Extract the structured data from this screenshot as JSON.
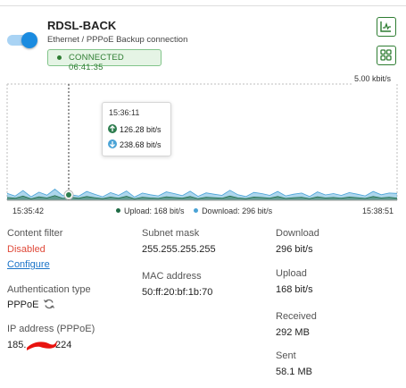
{
  "connection": {
    "name": "RDSL-BACK",
    "description": "Ethernet / PPPoE Backup connection",
    "status": "CONNECTED 06:41:35",
    "enabled": true
  },
  "chart": {
    "max_label": "5.00 kbit/s",
    "x_start": "15:35:42",
    "x_end": "15:38:51",
    "legend_upload": "Upload: 168 bit/s",
    "legend_download": "Download: 296 bit/s",
    "tooltip": {
      "time": "15:36:11",
      "upload": "126.28 bit/s",
      "download": "238.68 bit/s"
    }
  },
  "chart_data": {
    "type": "area",
    "ylim": [
      0,
      5000
    ],
    "series": [
      {
        "name": "Upload",
        "color": "#1f6b45",
        "values": [
          120,
          90,
          180,
          60,
          150,
          100,
          200,
          80,
          126,
          90,
          160,
          110,
          70,
          140,
          90,
          170,
          60,
          130,
          100,
          80,
          150,
          120,
          90,
          160,
          70,
          130,
          110,
          90,
          180,
          100,
          70,
          140,
          120,
          90,
          160,
          80,
          110,
          130,
          70,
          150,
          100,
          120,
          90,
          140,
          110,
          80,
          160,
          100,
          130,
          90
        ]
      },
      {
        "name": "Download",
        "color": "#4aa3d6",
        "values": [
          300,
          180,
          420,
          150,
          350,
          220,
          480,
          200,
          239,
          180,
          380,
          260,
          150,
          330,
          210,
          400,
          140,
          310,
          240,
          190,
          360,
          290,
          200,
          390,
          170,
          320,
          260,
          210,
          430,
          240,
          160,
          340,
          290,
          210,
          380,
          190,
          260,
          310,
          160,
          360,
          230,
          290,
          210,
          330,
          260,
          190,
          380,
          240,
          310,
          296
        ]
      }
    ]
  },
  "info": {
    "content_filter_label": "Content filter",
    "content_filter_value": "Disabled",
    "configure_link": "Configure",
    "auth_type_label": "Authentication type",
    "auth_type_value": "PPPoE",
    "ip_label": "IP address (PPPoE)",
    "ip_prefix": "185.",
    "ip_suffix": "224",
    "subnet_label": "Subnet mask",
    "subnet_value": "255.255.255.255",
    "mac_label": "MAC address",
    "mac_value": "50:ff:20:bf:1b:70",
    "download_label": "Download",
    "download_value": "296 bit/s",
    "upload_label": "Upload",
    "upload_value": "168 bit/s",
    "received_label": "Received",
    "received_value": "292 MB",
    "sent_label": "Sent",
    "sent_value": "58.1 MB"
  },
  "icons": {
    "chart_button": "line-chart-icon",
    "grid_button": "grid-view-icon",
    "refresh": "refresh-icon"
  }
}
